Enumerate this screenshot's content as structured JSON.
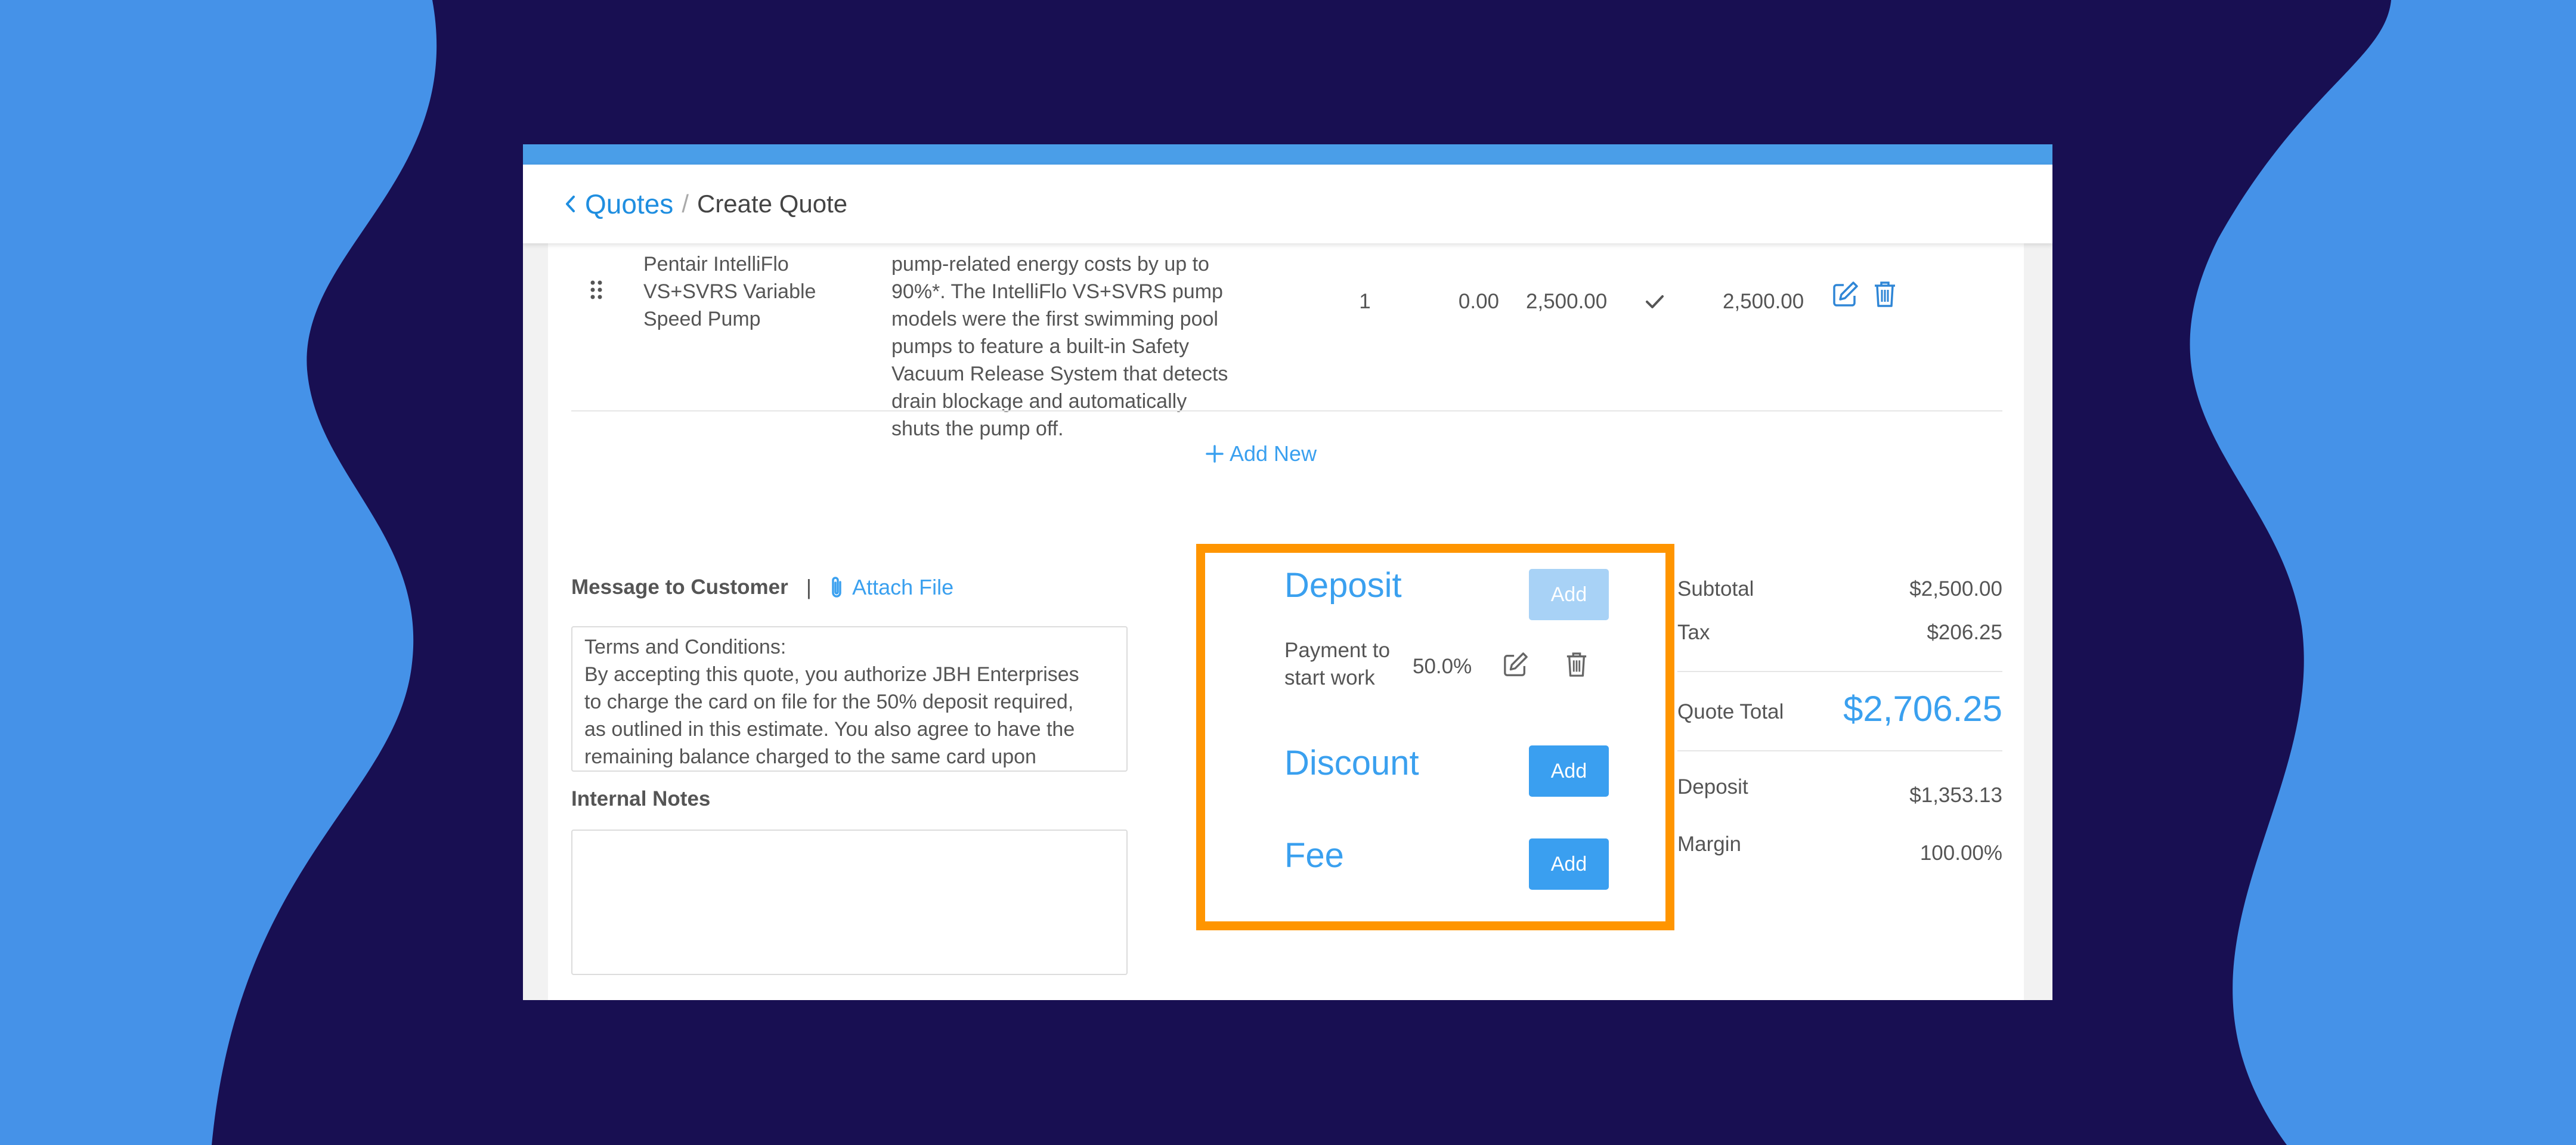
{
  "header": {
    "back_label": "Quotes",
    "separator": "/",
    "current_page": "Create Quote"
  },
  "line_item": {
    "product_name": "Pentair IntelliFlo\nVS+SVRS Variable\nSpeed Pump",
    "description": "pump-related energy costs by up to\n90%*. The IntelliFlo VS+SVRS pump\nmodels were the first swimming pool\npumps to feature a built-in Safety\nVacuum Release System that detects\ndrain blockage and automatically\nshuts the pump off.",
    "quantity": "1",
    "discount": "0.00",
    "unit_price": "2,500.00",
    "total": "2,500.00"
  },
  "add_new_label": "Add New",
  "message": {
    "label": "Message to Customer",
    "separator": "|",
    "attach_label": "Attach File",
    "text": "Terms and Conditions:\nBy accepting this quote, you authorize JBH Enterprises\nto charge the card on file for the 50% deposit required,\nas outlined in this estimate. You also agree to have the\nremaining balance charged to the same card upon"
  },
  "internal_notes": {
    "label": "Internal Notes",
    "value": ""
  },
  "adjustments": {
    "deposit": {
      "title": "Deposit",
      "add_label": "Add",
      "item_label": "Payment to\nstart work",
      "item_value": "50.0%"
    },
    "discount": {
      "title": "Discount",
      "add_label": "Add"
    },
    "fee": {
      "title": "Fee",
      "add_label": "Add"
    }
  },
  "summary": {
    "subtotal_label": "Subtotal",
    "subtotal": "$2,500.00",
    "tax_label": "Tax",
    "tax": "$206.25",
    "quote_total_label": "Quote Total",
    "quote_total": "$2,706.25",
    "deposit_label": "Deposit",
    "deposit": "$1,353.13",
    "margin_label": "Margin",
    "margin": "100.00%"
  },
  "colors": {
    "accent": "#3aa0ef",
    "highlight": "#ff9500",
    "background_blue": "#4592e8",
    "background_navy": "#180f52"
  },
  "icons": [
    "chevron-left-icon",
    "drag-handle-icon",
    "check-icon",
    "edit-icon",
    "trash-icon",
    "plus-icon",
    "paperclip-icon"
  ]
}
